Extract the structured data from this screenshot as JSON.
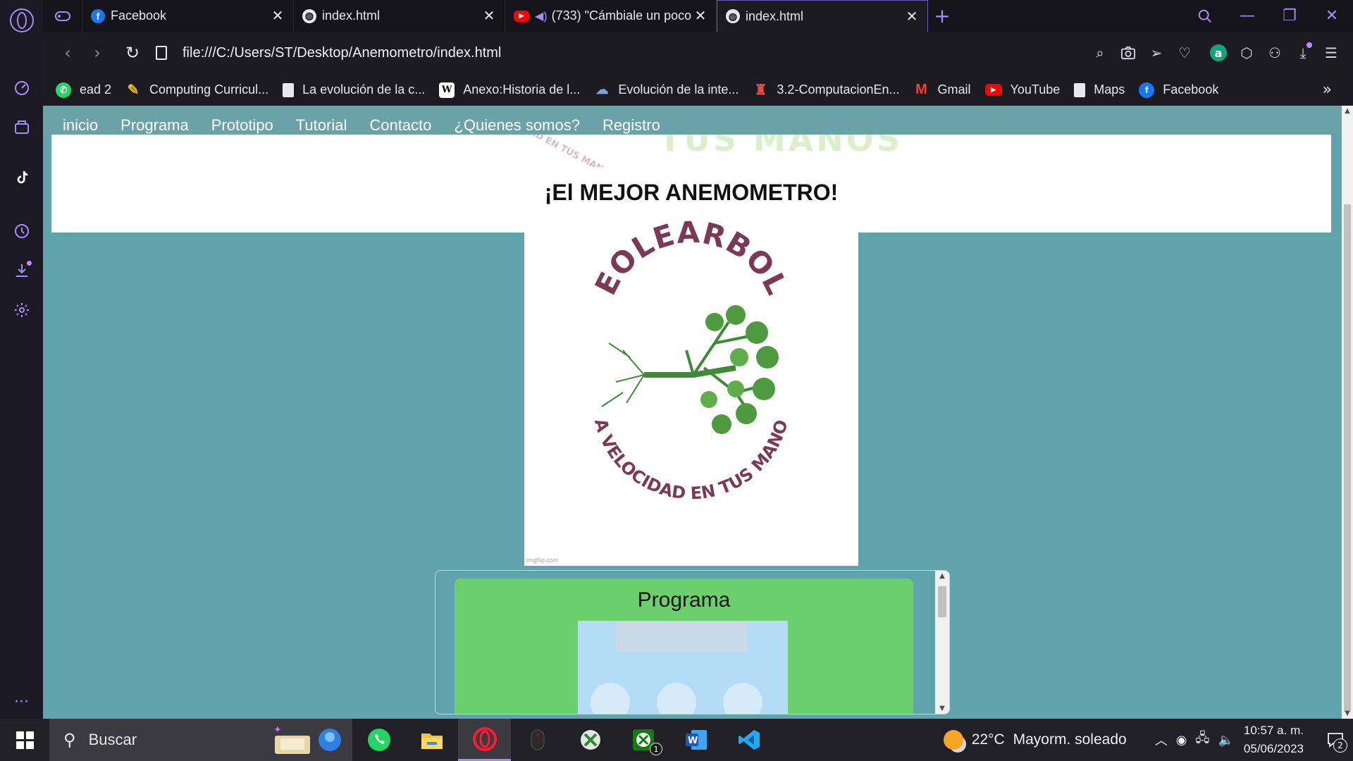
{
  "tabs": [
    {
      "title": "Facebook",
      "favicon": "facebook-icon"
    },
    {
      "title": "index.html",
      "favicon": "globe-icon"
    },
    {
      "title": "(733) \"Cámbiale un poco",
      "favicon": "youtube-icon",
      "audio": true
    },
    {
      "title": "index.html",
      "favicon": "globe-icon",
      "active": true
    }
  ],
  "address": {
    "url": "file:///C:/Users/ST/Desktop/Anemometro/index.html"
  },
  "bookmarks": [
    {
      "label": "ead 2",
      "icon": "whatsapp-icon"
    },
    {
      "label": "Computing Curricul...",
      "icon": "pencil-icon"
    },
    {
      "label": "La evolución de la c...",
      "icon": "document-icon"
    },
    {
      "label": "Anexo:Historia de l...",
      "icon": "wikipedia-icon"
    },
    {
      "label": "Evolución de la inte...",
      "icon": "internet-icon"
    },
    {
      "label": "3.2-ComputacionEn...",
      "icon": "computer-icon"
    },
    {
      "label": "Gmail",
      "icon": "gmail-icon"
    },
    {
      "label": "YouTube",
      "icon": "youtube-icon"
    },
    {
      "label": "Maps",
      "icon": "document-icon"
    },
    {
      "label": "Facebook",
      "icon": "facebook-icon"
    }
  ],
  "page": {
    "nav": [
      "inicio",
      "Programa",
      "Prototipo",
      "Tutorial",
      "Contacto",
      "¿Quienes somos?",
      "Registro"
    ],
    "banner_title": "TUS MANOS",
    "banner_slogan": "LA VELOCIDAD EN TUS MANOS",
    "hero_title": "¡El MEJOR ANEMOMETRO!",
    "logo_top_text": "EOLEARBOL",
    "logo_bottom_text": "LA VELOCIDAD EN TUS MANOS",
    "imgflip": "imgflip.com",
    "program_title": "Programa",
    "colors": {
      "page_bg": "#61a3ad",
      "program_card": "#6bd06b",
      "logo_text": "#7a3a55",
      "tree": "#3f8a3a"
    }
  },
  "taskbar": {
    "search_placeholder": "Buscar",
    "apps": [
      "whatsapp-icon",
      "file-explorer-icon",
      "opera-icon",
      "mouse-app-icon",
      "xbox-icon",
      "xbox-game-bar-icon",
      "word-icon",
      "vscode-icon"
    ],
    "xbox_badge": "1",
    "weather": {
      "temp": "22°C",
      "condition": "Mayorm. soleado"
    },
    "time": "10:57 a. m.",
    "date": "05/06/2023",
    "notifications": "2"
  }
}
